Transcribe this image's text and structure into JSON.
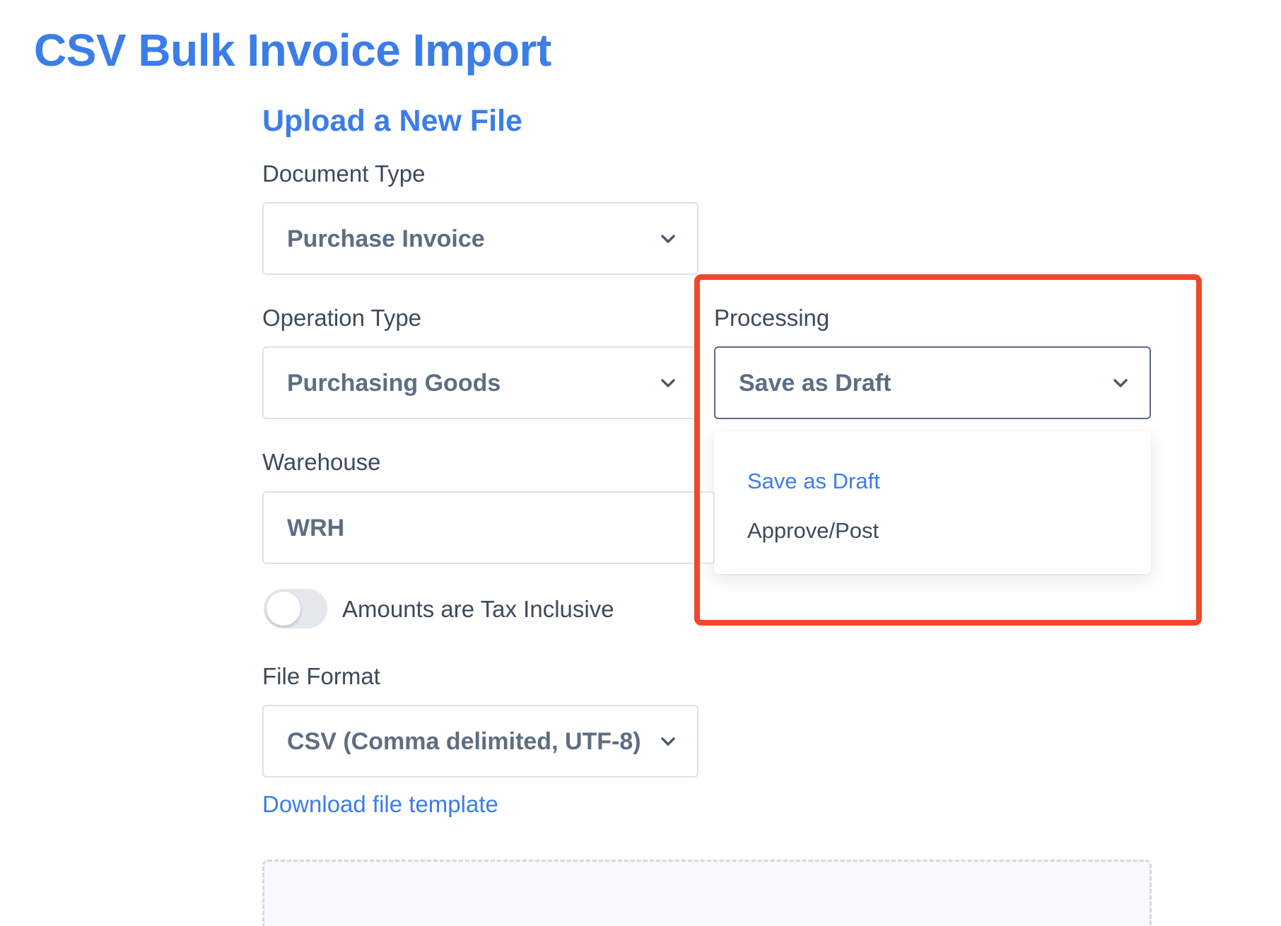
{
  "page": {
    "title": "CSV Bulk Invoice Import"
  },
  "form": {
    "section_title": "Upload a New File",
    "document_type": {
      "label": "Document Type",
      "value": "Purchase Invoice"
    },
    "operation_type": {
      "label": "Operation Type",
      "value": "Purchasing Goods"
    },
    "processing": {
      "label": "Processing",
      "value": "Save as Draft",
      "options": [
        "Save as Draft",
        "Approve/Post"
      ],
      "selected_index": 0
    },
    "warehouse": {
      "label": "Warehouse",
      "value": "WRH"
    },
    "tax_inclusive": {
      "label": "Amounts are Tax Inclusive",
      "checked": false
    },
    "file_format": {
      "label": "File Format",
      "value": "CSV (Comma delimited, UTF-8)"
    },
    "download_template_label": "Download file template"
  },
  "colors": {
    "accent": "#3b7de9",
    "highlight": "#f0482b",
    "label_text": "#3d4a5c",
    "value_text": "#5d6e83"
  }
}
